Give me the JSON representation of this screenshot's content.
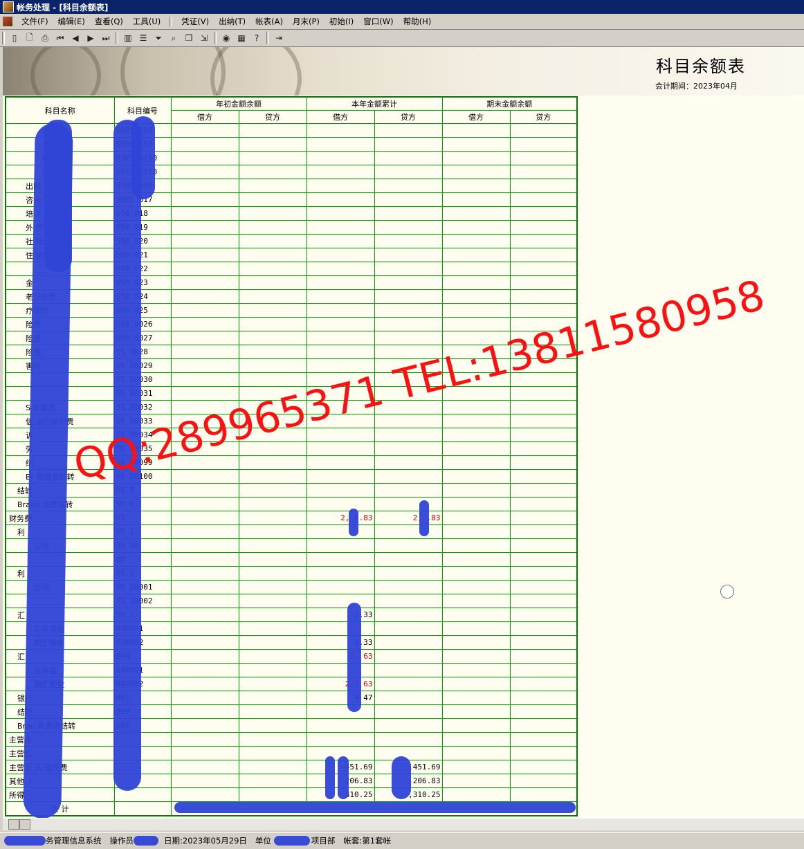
{
  "window": {
    "title": "帐务处理 - [科目余额表]"
  },
  "menu": [
    "文件(F)",
    "编辑(E)",
    "查看(Q)",
    "工具(U)",
    "凭证(V)",
    "出纳(T)",
    "帐表(A)",
    "月末(P)",
    "初始(I)",
    "窗口(W)",
    "帮助(H)"
  ],
  "toolbar_icons": [
    "view-icon",
    "preview-icon",
    "print-icon",
    "first-icon",
    "prev-icon",
    "next-icon",
    "last-icon",
    "columns-icon",
    "list-icon",
    "filter-icon",
    "find-icon",
    "copy-icon",
    "export-icon",
    "money-icon",
    "calc-icon",
    "help-icon",
    "exit-icon"
  ],
  "report": {
    "title": "科目余额表",
    "period": "会计期间：2023年04月"
  },
  "headers": {
    "name": "科目名称",
    "code": "科目编号",
    "group_open": "年初金额余额",
    "group_cur": "本年金额累计",
    "group_end": "期末金额余额",
    "debit": "借方",
    "credit": "贷方"
  },
  "rows": [
    {
      "name": "招  材料",
      "code": "5505  150",
      "indent": 4
    },
    {
      "name": "公  杂费",
      "code": "5505  150",
      "indent": 4
    },
    {
      "name": "  待费",
      "code": "5505  0150",
      "indent": 4
    },
    {
      "name": "  待费",
      "code": "5505  0150",
      "indent": 4
    },
    {
      "name": "出国  经费",
      "code": "5505  016",
      "indent": 2
    },
    {
      "name": "咨询",
      "code": "5505  017",
      "indent": 2
    },
    {
      "name": "培训",
      "code": "550  018",
      "indent": 2
    },
    {
      "name": "外  费",
      "code": "550  019",
      "indent": 2
    },
    {
      "name": "社  险费",
      "code": "550  020",
      "indent": 2
    },
    {
      "name": "住  积金",
      "code": "550  021",
      "indent": 2
    },
    {
      "name": "",
      "code": "550  022",
      "indent": 2
    },
    {
      "name": "  金",
      "code": "550  023",
      "indent": 2
    },
    {
      "name": "  老保险费",
      "code": "550  024",
      "indent": 2
    },
    {
      "name": "  疗保险",
      "code": "550  025",
      "indent": 2
    },
    {
      "name": "  险费",
      "code": "550  0026",
      "indent": 2
    },
    {
      "name": "  险费",
      "code": "550  0027",
      "indent": 2
    },
    {
      "name": "  险费",
      "code": "55  0028",
      "indent": 2
    },
    {
      "name": "  害险",
      "code": "55  80029",
      "indent": 2
    },
    {
      "name": "",
      "code": "55  80030",
      "indent": 2
    },
    {
      "name": "",
      "code": "55  80031",
      "indent": 2
    },
    {
      "name": "S  救援费",
      "code": "55  80032",
      "indent": 2
    },
    {
      "name": "信  运行维护费",
      "code": "55  80033",
      "indent": 2
    },
    {
      "name": "诉",
      "code": "55  80034",
      "indent": 2
    },
    {
      "name": "劳",
      "code": "55  80035",
      "indent": 2
    },
    {
      "name": "结",
      "code": "55  80099",
      "indent": 2
    },
    {
      "name": "Br  管理费结转",
      "code": "55  80100",
      "indent": 2
    },
    {
      "name": "结转",
      "code": "55  9",
      "indent": 1
    },
    {
      "name": "Brand  理费结转",
      "code": "55  0",
      "indent": 1
    },
    {
      "name": "财务费",
      "code": "55",
      "indent": 0,
      "cur_debit": "2,  0.83",
      "cur_credit": "2,  .83",
      "red": true
    },
    {
      "name": "利",
      "code": "55  1",
      "indent": 1
    },
    {
      "name": "  公司",
      "code": "55  00",
      "indent": 3
    },
    {
      "name": "",
      "code": "  00",
      "indent": 3
    },
    {
      "name": "利",
      "code": "55  2",
      "indent": 1
    },
    {
      "name": "  公司",
      "code": "55  20001",
      "indent": 3
    },
    {
      "name": "",
      "code": "55  20002",
      "indent": 3
    },
    {
      "name": "汇",
      "code": "55  3",
      "indent": 1,
      "cur_debit": "  1.33"
    },
    {
      "name": "  汇兑损失",
      "code": "  030001",
      "indent": 3
    },
    {
      "name": "  购汇损失",
      "code": "  030002",
      "indent": 3,
      "cur_debit": "  1.33"
    },
    {
      "name": "汇",
      "code": "  004",
      "indent": 1,
      "cur_debit": "2,  63",
      "red": true
    },
    {
      "name": "  兑收益",
      "code": "  040001",
      "indent": 3
    },
    {
      "name": "  购汇收益",
      "code": "  040002",
      "indent": 3,
      "cur_debit": "2,7  63",
      "red": true
    },
    {
      "name": "银行",
      "code": "  005",
      "indent": 1,
      "cur_debit": "4  47"
    },
    {
      "name": "结转",
      "code": "  099",
      "indent": 1
    },
    {
      "name": "Bran  务费用结转",
      "code": "  100",
      "indent": 1
    },
    {
      "name": "主营业",
      "code": "",
      "indent": 0
    },
    {
      "name": "主营业",
      "code": "",
      "indent": 0
    },
    {
      "name": "主营业  入-操作费",
      "code": "",
      "indent": 0,
      "cur_debit": "  451.69",
      "cur_credit": "  ,451.69"
    },
    {
      "name": "其他  入",
      "code": "",
      "indent": 0,
      "cur_debit": "  206.83",
      "cur_credit": "  ,206.83"
    },
    {
      "name": "所得",
      "code": "",
      "indent": 0,
      "cur_debit": "  310.25",
      "cur_credit": "  ,310.25"
    }
  ],
  "total_label": "合  计",
  "watermark": "QQ:289965371 TEL:13811580958",
  "status": {
    "system": "  务管理信息系统",
    "operator": "操作员",
    "date": "日期:2023年05月29日",
    "unit_prefix": "单位",
    "unit_suffix": "项目部",
    "book": "帐套:第1套帐"
  }
}
